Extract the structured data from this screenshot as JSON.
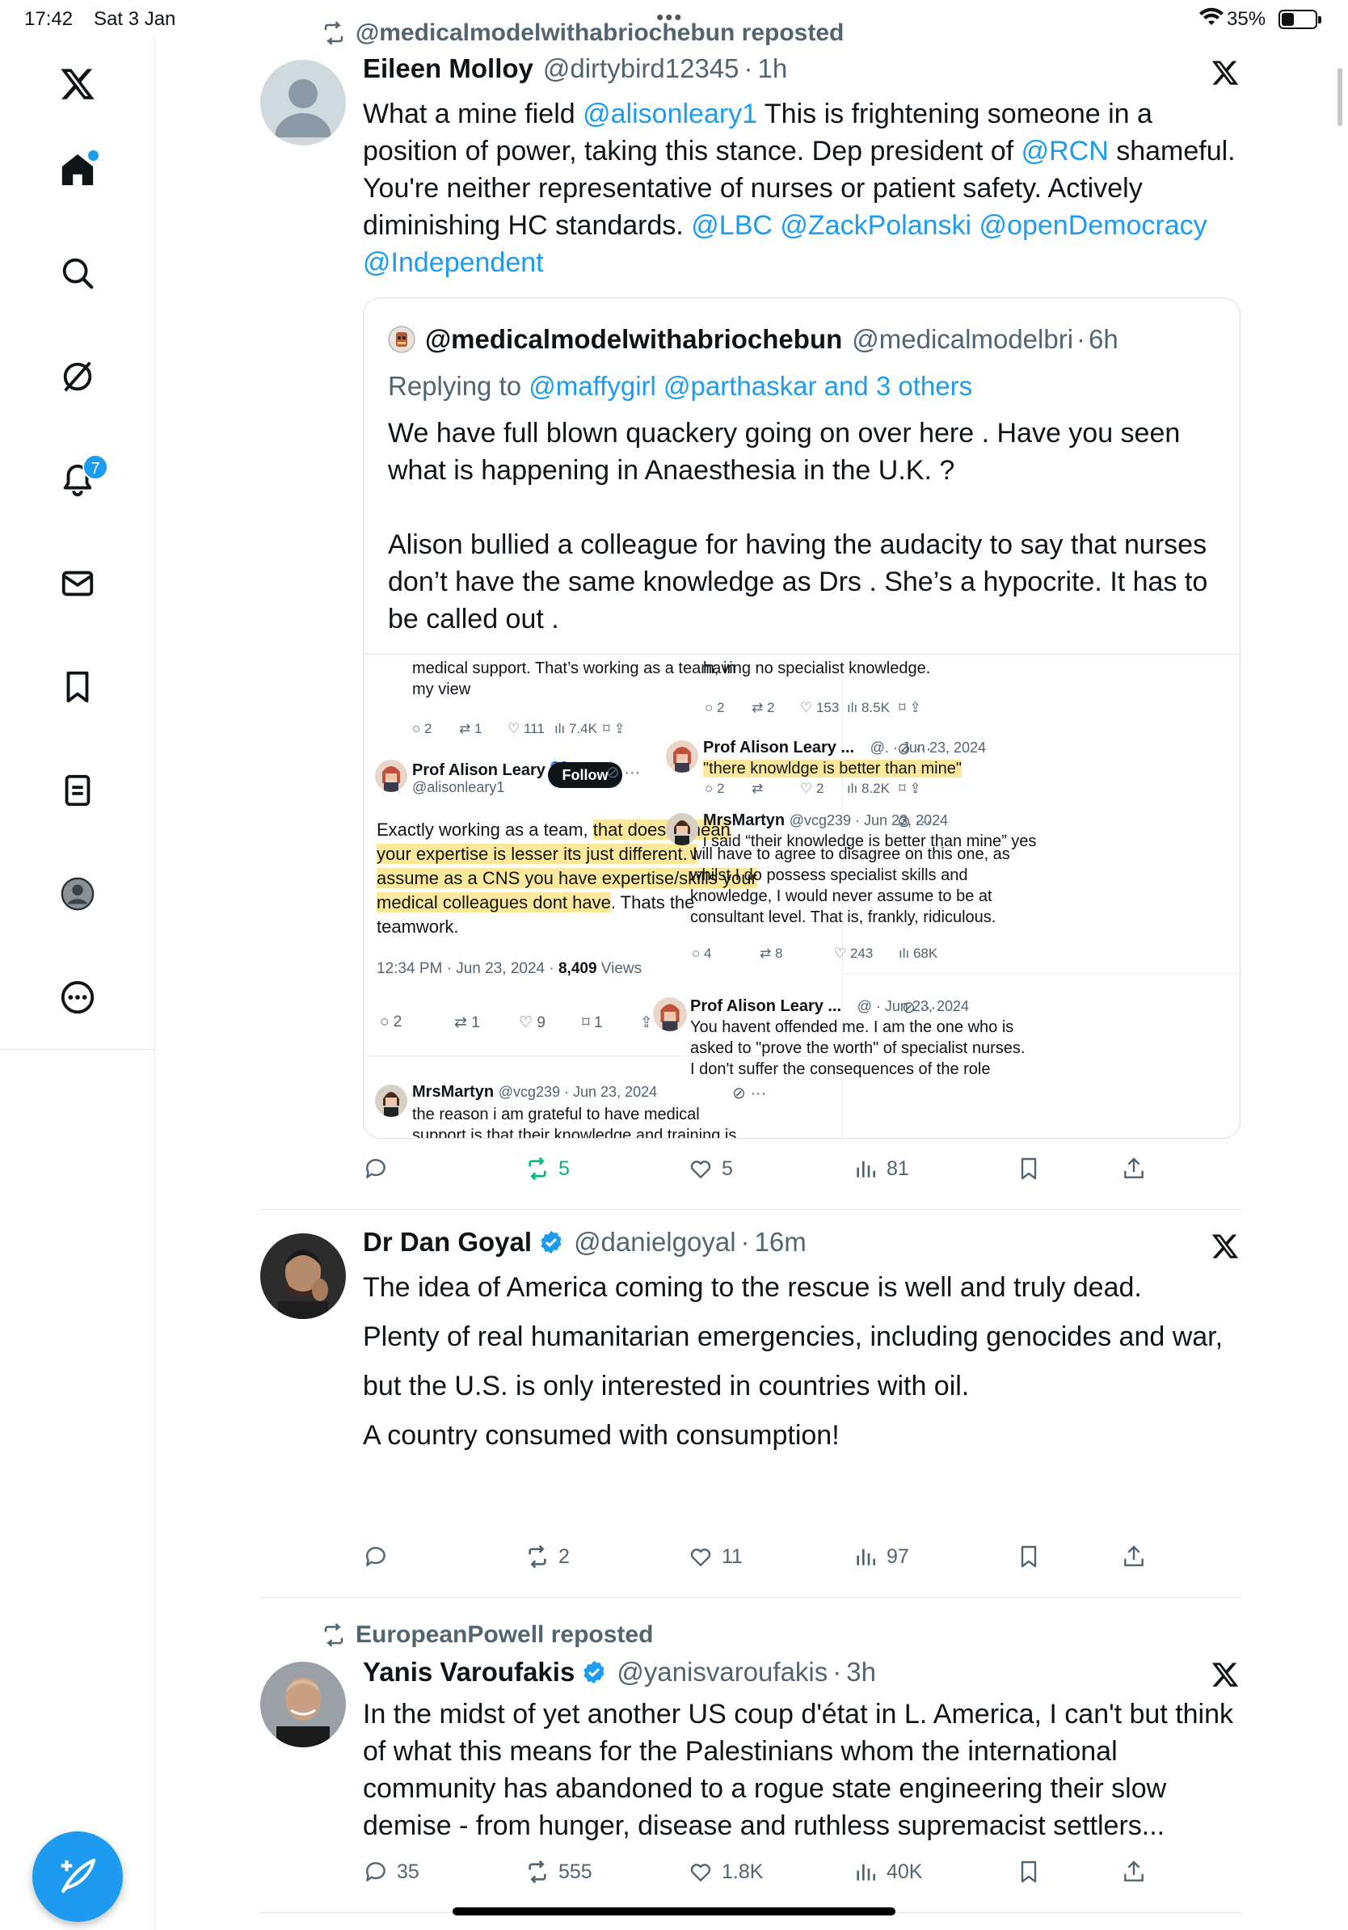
{
  "status_bar": {
    "time": "17:42",
    "date": "Sat 3 Jan",
    "battery": "35%",
    "battery_level": 0.35
  },
  "sidebar": {
    "items": [
      {
        "name": "x-logo",
        "label": "X"
      },
      {
        "name": "home",
        "label": "Home"
      },
      {
        "name": "search",
        "label": "Search"
      },
      {
        "name": "grok",
        "label": "Grok"
      },
      {
        "name": "notifications",
        "label": "Notifications",
        "badge": "7"
      },
      {
        "name": "messages",
        "label": "Messages"
      },
      {
        "name": "bookmarks",
        "label": "Bookmarks"
      },
      {
        "name": "lists",
        "label": "Lists"
      },
      {
        "name": "profile",
        "label": "Profile"
      },
      {
        "name": "more",
        "label": "More"
      }
    ],
    "compose_label": "Post"
  },
  "tweets": [
    {
      "repost_by": "@medicalmodelwithabriochebun reposted",
      "name": "Eileen Molloy",
      "handle": "@dirtybird12345",
      "dot": "·",
      "time": "1h",
      "lines": [
        {
          "parts": [
            {
              "t": "What a mine field "
            },
            {
              "t": "@alisonleary1",
              "link": true
            },
            {
              "t": " This is frightening someone in a"
            }
          ]
        },
        {
          "parts": [
            {
              "t": "position of power, taking this stance. Dep president of "
            },
            {
              "t": "@RCN",
              "link": true
            },
            {
              "t": " shameful."
            }
          ]
        },
        {
          "parts": [
            {
              "t": "You're neither representative of nurses or patient safety. Actively"
            }
          ]
        },
        {
          "parts": [
            {
              "t": "diminishing HC standards. "
            },
            {
              "t": "@LBC @ZackPolanski @openDemocracy",
              "link": true
            }
          ]
        },
        {
          "parts": [
            {
              "t": "@Independent",
              "link": true
            }
          ]
        }
      ],
      "quote": {
        "name": "@medicalmodelwithabriochebun",
        "handle": "@medicalmodelbri",
        "dot": "·",
        "time": "6h",
        "reply_prefix": "Replying to ",
        "reply_to": "@maffygirl @parthaskar and 3 others",
        "lines": [
          "We have full blown quackery going on over here . Have you seen",
          "what is happening in Anaesthesia in the U.K. ?",
          "",
          "Alison bullied a colleague for having the audacity to say that nurses",
          "don’t have the same knowledge as Drs . She’s a hypocrite.  It has to",
          "be called out ."
        ],
        "screenshot": {
          "left": {
            "top_text_1": "medical support. That’s working as a team, in",
            "top_text_2": "my view",
            "top_actions": [
              "2",
              "1",
              "111",
              "7.4K"
            ],
            "post_name": "Prof Alison Leary 💙#Pr...",
            "post_handle": "@alisonleary1",
            "follow": "Follow",
            "line1_a": "Exactly working as a team, ",
            "line1_b": "that doesnt mean",
            "line2": "your expertise is lesser its just different. I",
            "line3": "assume as a CNS you have expertise/skills your",
            "line4_a": "medical colleagues dont have",
            "line4_b": ". Thats the",
            "line5": "teamwork.",
            "timestamp": "12:34 PM · Jun 23, 2024 · ",
            "views_count": "8,409",
            "views_label": " Views",
            "actions": [
              "2",
              "1",
              "9",
              "1"
            ],
            "reply_name": "MrsMartyn",
            "reply_handle": "@vcg239 · Jun 23, 2024",
            "reply_text_1": "the reason i am grateful to have medical",
            "reply_text_2": "support is that their knowledge and training is"
          },
          "right": {
            "top_text": "having no specialist knowledge.",
            "top_actions": [
              "2",
              "2",
              "153",
              "8.5K"
            ],
            "p1_name": "Prof Alison Leary ...",
            "p1_handle": "@. · Jun 23, 2024",
            "p1_text": "\"there knowldge is better than mine\"",
            "p1_actions": [
              "2",
              "",
              "2",
              "8.2K"
            ],
            "p2_name": "MrsMartyn",
            "p2_handle": "@vcg239 · Jun 23, 2024",
            "p2_text_1": "i said “their knowledge is better than mine” yes",
            "p2_text_2": "will have to agree to disagree on this one, as",
            "p2_text_3": "whilst I do possess specialist skills and",
            "p2_text_4": "knowledge, I would never assume to be at",
            "p2_text_5": "consultant level. That is, frankly, ridiculous.",
            "p2_actions": [
              "4",
              "8",
              "243",
              "68K"
            ],
            "p3_name": "Prof Alison Leary ...",
            "p3_handle": "@ · Jun 23, 2024",
            "p3_text_1": "You havent offended me. I am the one who is",
            "p3_text_2": "asked to \"prove the worth\" of specialist nurses.",
            "p3_text_3": "I don't suffer the consequences of the role"
          }
        }
      },
      "actions": {
        "replies": "",
        "reposts": "5",
        "likes": "5",
        "views": "81"
      }
    },
    {
      "name": "Dr Dan Goyal",
      "handle": "@danielgoyal",
      "dot": "·",
      "time": "16m",
      "lines": [
        "The idea of America coming to the rescue is well and truly dead.",
        "",
        "Plenty of real humanitarian emergencies, including genocides and war,",
        "",
        "but the U.S. is only interested in countries with oil.",
        "",
        "A country consumed with consumption!"
      ],
      "actions": {
        "replies": "",
        "reposts": "2",
        "likes": "11",
        "views": "97"
      }
    },
    {
      "repost_by": "EuropeanPowell reposted",
      "name": "Yanis Varoufakis",
      "handle": "@yanisvaroufakis",
      "dot": "·",
      "time": "3h",
      "lines": [
        "In the midst of yet another US coup d'état in L. America, I can't but think",
        "of what this means for the Palestinians whom the international",
        "community has abandoned to a rogue state engineering their slow",
        "demise - from hunger, disease and ruthless supremacist settlers..."
      ],
      "actions": {
        "replies": "35",
        "reposts": "555",
        "likes": "1.8K",
        "views": "40K"
      }
    }
  ],
  "colors": {
    "accent": "#1d9bf0",
    "repost_active": "#00ba7c",
    "text": "#0f1419",
    "muted": "#536471",
    "highlight": "#fbe89a"
  }
}
